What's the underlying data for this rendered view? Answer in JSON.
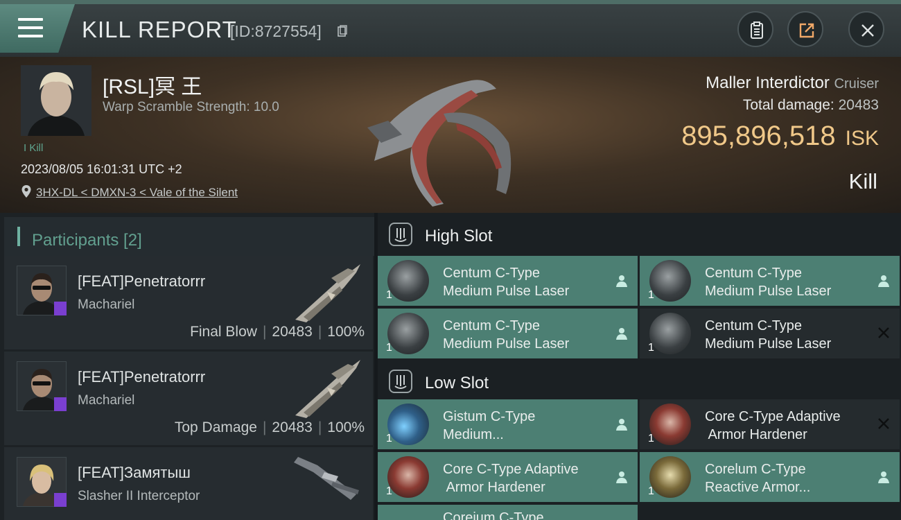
{
  "header": {
    "title": "KILL REPORT",
    "kill_id": "[ID:8727554]",
    "icons": [
      "menu-icon",
      "copy-icon",
      "clipboard-icon",
      "share-icon",
      "close-icon"
    ]
  },
  "summary": {
    "pilot_name": "[RSL]冥 王",
    "warp_scramble": "Warp Scramble Strength: 10.0",
    "kill_count": "I Kill",
    "timestamp": "2023/08/05 16:01:31 UTC +2",
    "location": "3HX-DL < DMXN-3 < Vale of the Silent",
    "ship_name": "Maller Interdictor",
    "ship_class": "Cruiser",
    "total_damage_label": "Total damage:",
    "total_damage_value": "20483",
    "isk_value": "895,896,518",
    "isk_unit": "ISK",
    "result": "Kill",
    "isk_color": "#f0c889"
  },
  "participants": {
    "title": "Participants [2]",
    "rows": [
      {
        "name": "[FEAT]Penetratorrr",
        "ship": "Machariel",
        "role": "Final Blow",
        "damage": "20483",
        "percent": "100%"
      },
      {
        "name": "[FEAT]Penetratorrr",
        "ship": "Machariel",
        "role": "Top Damage",
        "damage": "20483",
        "percent": "100%"
      },
      {
        "name": "[FEAT]Замятыш",
        "ship": "Slasher II Interceptor"
      }
    ]
  },
  "fittings": {
    "high_slot_label": "High Slot",
    "low_slot_label": "Low Slot",
    "high": [
      {
        "line1": "Centum C-Type",
        "line2": "Medium Pulse Laser",
        "qty": "1",
        "status": "person"
      },
      {
        "line1": "Centum C-Type",
        "line2": "Medium Pulse Laser",
        "qty": "1",
        "status": "person"
      },
      {
        "line1": "Centum C-Type",
        "line2": "Medium Pulse Laser",
        "qty": "1",
        "status": "person"
      },
      {
        "line1": "Centum C-Type",
        "line2": "Medium Pulse Laser",
        "qty": "1",
        "status": "destroyed"
      }
    ],
    "low": [
      {
        "line1": "Gistum C-Type",
        "line2": "Medium...",
        "qty": "1",
        "status": "person"
      },
      {
        "line1": "Core C-Type Adaptive",
        "line2": " Armor Hardener",
        "qty": "1",
        "status": "destroyed"
      },
      {
        "line1": "Core C-Type Adaptive",
        "line2": " Armor Hardener",
        "qty": "1",
        "status": "person"
      },
      {
        "line1": "Corelum C-Type",
        "line2": "Reactive Armor...",
        "qty": "1",
        "status": "person"
      }
    ],
    "partial_next": "Coreium C-Type"
  },
  "colors": {
    "accent": "#5fa58f",
    "dropped_module_bg": "#4c7f73",
    "destroyed_module_bg": "#252b2e",
    "implant_badge": "#7a3fd0"
  }
}
